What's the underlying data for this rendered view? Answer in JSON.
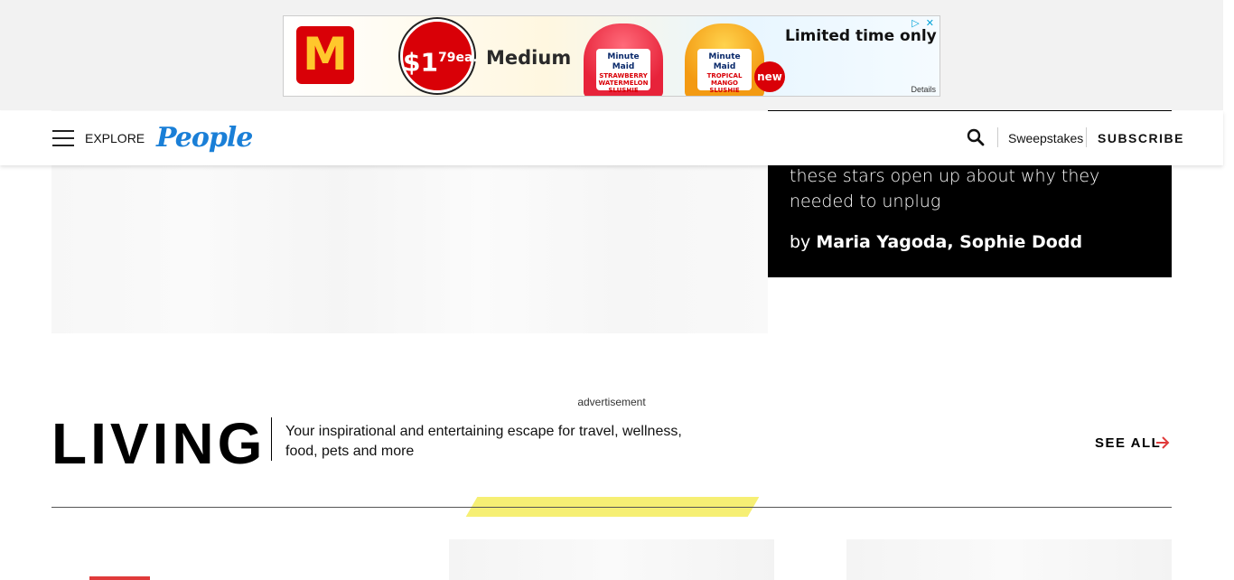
{
  "ad": {
    "brand_logo": "M",
    "price_dollar": "$1",
    "price_cents": "79",
    "price_unit": "ea.",
    "size_text": "Medium",
    "cup1_brand": "Minute Maid",
    "cup1_flavor": "STRAWBERRY WATERMELON SLUSHIE",
    "cup2_brand": "Minute Maid",
    "cup2_flavor": "TROPICAL MANGO SLUSHIE",
    "headline": "Limited time only",
    "badge": "new",
    "details": "Details",
    "adchoices_icon": "▷ ✕"
  },
  "header": {
    "explore_label": "EXPLORE",
    "logo_text": "People",
    "sweepstakes_label": "Sweepstakes",
    "subscribe_label": "SUBSCRIBE"
  },
  "feature": {
    "blurb": "these stars open up about why they needed to unplug",
    "by_prefix": "by ",
    "authors": "Maria Yagoda, Sophie Dodd"
  },
  "advertisement_label": "advertisement",
  "living": {
    "title": "LIVING",
    "description": "Your inspirational and entertaining escape for travel, wellness, food, pets and more",
    "see_all": "SEE ALL"
  },
  "colors": {
    "brand_blue": "#1a7fd7",
    "highlight_yellow": "#f6ef74",
    "accent_red": "#e03a3a"
  }
}
